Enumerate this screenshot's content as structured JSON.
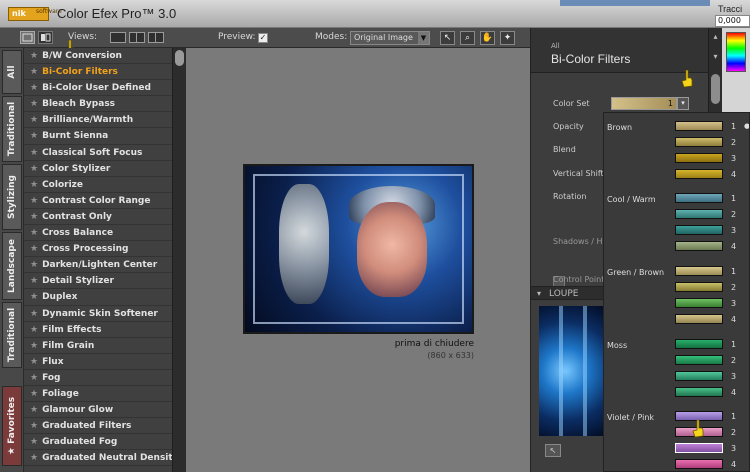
{
  "app": {
    "title": "Color Efex Pro™ 3.0",
    "logo_text": "nik",
    "logo_sub": "software",
    "tracing_label": "Tracci",
    "tracing_value": "0,000"
  },
  "toolbar": {
    "views_label": "Views:",
    "preview_label": "Preview:",
    "preview_check": "✓",
    "modes_label": "Modes:",
    "modes_value": "Original Image",
    "tools": [
      "↖",
      "⌕",
      "✋",
      "✦"
    ]
  },
  "vertical_tabs": [
    "All",
    "Traditional",
    "Stylizing",
    "Landscape",
    "Traditional",
    "Favorites"
  ],
  "filters": [
    "B/W Conversion",
    "Bi-Color Filters",
    "Bi-Color User Defined",
    "Bleach Bypass",
    "Brilliance/Warmth",
    "Burnt Sienna",
    "Classical Soft Focus",
    "Color Stylizer",
    "Colorize",
    "Contrast Color Range",
    "Contrast Only",
    "Cross Balance",
    "Cross Processing",
    "Darken/Lighten Center",
    "Detail Stylizer",
    "Duplex",
    "Dynamic Skin Softener",
    "Film Effects",
    "Film Grain",
    "Flux",
    "Fog",
    "Foliage",
    "Glamour Glow",
    "Graduated Filters",
    "Graduated Fog",
    "Graduated Neutral Density"
  ],
  "selected_filter_index": 1,
  "preview": {
    "caption": "prima di chiudere",
    "dimensions": "(860 x 633)"
  },
  "right_panel": {
    "category": "All",
    "filter_name": "Bi-Color Filters",
    "color_set_label": "Color Set",
    "color_set_value": "1",
    "color_set_button": "▾",
    "opacity_label": "Opacity",
    "blend_label": "Blend",
    "vertical_shift_label": "Vertical Shift",
    "rotation_label": "Rotation",
    "shadows_label": "Shadows / H",
    "control_points_label": "Control Points",
    "loupe_label": "LOUPE",
    "loupe_toggle": "▾",
    "scroll_up": "▴",
    "scroll_down": "▾"
  },
  "color_sets": [
    {
      "group": "Brown",
      "swatches": [
        [
          "#d3c08a",
          "#9f8a55"
        ],
        [
          "#cdbd6a",
          "#8f7d3d"
        ],
        [
          "#c8a51f",
          "#8d6f10"
        ],
        [
          "#d6b52c",
          "#9c7f15"
        ]
      ]
    },
    {
      "group": "Cool / Warm",
      "swatches": [
        [
          "#6ea6b8",
          "#3d6f80"
        ],
        [
          "#5fb2b0",
          "#2f7672"
        ],
        [
          "#3d9f9a",
          "#1f6461"
        ],
        [
          "#a4b38a",
          "#6d7a52"
        ]
      ]
    },
    {
      "group": "Green / Brown",
      "swatches": [
        [
          "#d8c98e",
          "#9a8c55"
        ],
        [
          "#c8c06a",
          "#857c30"
        ],
        [
          "#6fbf63",
          "#3a7f32"
        ],
        [
          "#d4c58a",
          "#948553"
        ]
      ]
    },
    {
      "group": "Moss",
      "swatches": [
        [
          "#28b06a",
          "#137041"
        ],
        [
          "#36c07a",
          "#1a7a48"
        ],
        [
          "#52c89a",
          "#237e5e"
        ],
        [
          "#4ac088",
          "#1f7650"
        ]
      ]
    },
    {
      "group": "Violet / Pink",
      "swatches": [
        [
          "#b8a0e8",
          "#7960b0"
        ],
        [
          "#e8a0c8",
          "#b0608f"
        ],
        [
          "#c080d8",
          "#8050a0"
        ],
        [
          "#e870b0",
          "#b03c7c"
        ]
      ]
    }
  ],
  "selected_color_set": "1",
  "colors": {
    "accent": "#f3a21c",
    "list_bg": "#404040",
    "preview_bg": "#7a7a7a",
    "panel_bg": "#3d3d3d",
    "titlebar": "#c8c8c8"
  }
}
